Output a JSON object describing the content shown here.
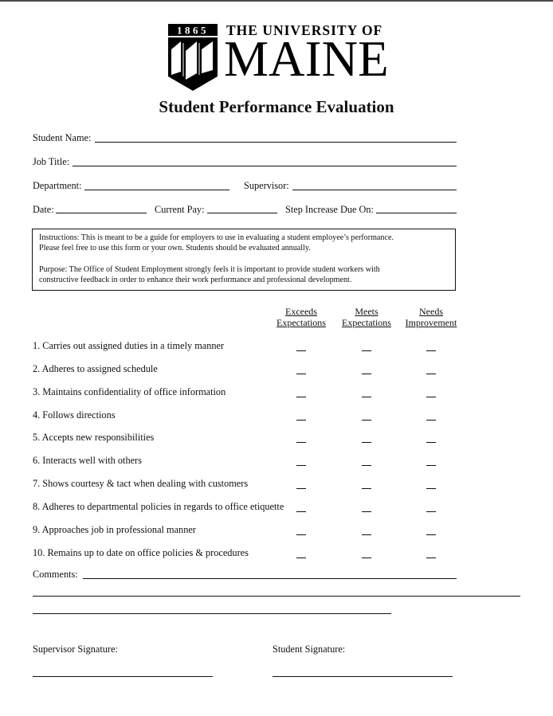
{
  "logo": {
    "year": "1865",
    "line1": "THE UNIVERSITY OF",
    "line2": "MAINE",
    "icon": "university-shield-icon"
  },
  "title": "Student Performance Evaluation",
  "fields": {
    "student_name": {
      "label": "Student Name:",
      "value": ""
    },
    "job_title": {
      "label": "Job Title:",
      "value": ""
    },
    "department": {
      "label": "Department:",
      "value": ""
    },
    "supervisor": {
      "label": "Supervisor:",
      "value": ""
    },
    "date": {
      "label": "Date:",
      "value": ""
    },
    "current_pay": {
      "label": "Current Pay:",
      "value": ""
    },
    "step_increase": {
      "label": "Step Increase Due On:",
      "value": ""
    }
  },
  "instructions": {
    "line1": "Instructions: This is meant to be a guide for employers to use in evaluating a student employee’s performance.",
    "line2": "Please feel free to use this form or your own. Students should be evaluated annually.",
    "line3": "Purpose: The Office of Student Employment strongly feels it is important to provide student workers with",
    "line4": "constructive feedback in order to enhance their work performance and professional development."
  },
  "rating_columns": [
    {
      "line1": "Exceeds",
      "line2": "Expectations"
    },
    {
      "line1": "Meets",
      "line2": "Expectations"
    },
    {
      "line1": "Needs",
      "line2": "Improvement"
    }
  ],
  "criteria": [
    "1. Carries out assigned duties in a timely manner",
    "2. Adheres to assigned schedule",
    "3. Maintains confidentiality of office information",
    "4. Follows directions",
    "5. Accepts new responsibilities",
    "6. Interacts well with others",
    "7. Shows courtesy & tact when dealing with customers",
    "8. Adheres to departmental policies in regards to office etiquette",
    "9. Approaches job in professional manner",
    "10. Remains up to date on office policies & procedures"
  ],
  "comments": {
    "label": "Comments:",
    "value": ""
  },
  "signatures": {
    "supervisor": {
      "label": "Supervisor Signature:",
      "value": ""
    },
    "student": {
      "label": "Student Signature:",
      "value": ""
    }
  }
}
